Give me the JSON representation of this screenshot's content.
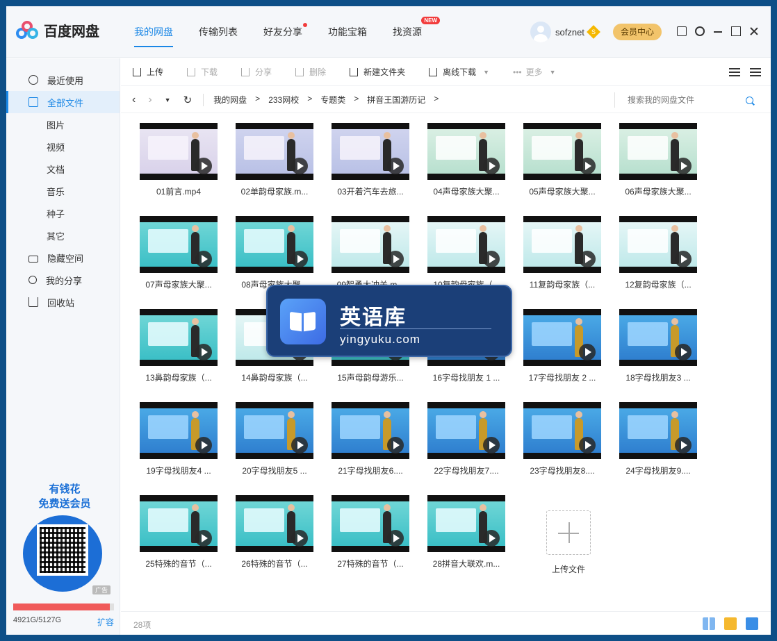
{
  "app": {
    "name": "百度网盘"
  },
  "nav": [
    {
      "label": "我的网盘",
      "active": true
    },
    {
      "label": "传输列表"
    },
    {
      "label": "好友分享",
      "dot": true
    },
    {
      "label": "功能宝箱"
    },
    {
      "label": "找资源",
      "badge": "NEW"
    }
  ],
  "user": {
    "name": "sofznet",
    "vip_mark": "S",
    "member_button": "会员中心"
  },
  "sidebar": {
    "items": [
      {
        "label": "最近使用",
        "icon": "clock-icon"
      },
      {
        "label": "全部文件",
        "icon": "document-icon",
        "active": true
      },
      {
        "label": "图片"
      },
      {
        "label": "视频"
      },
      {
        "label": "文档"
      },
      {
        "label": "音乐"
      },
      {
        "label": "种子"
      },
      {
        "label": "其它"
      },
      {
        "label": "隐藏空间",
        "icon": "lock-icon"
      },
      {
        "label": "我的分享",
        "icon": "share-icon"
      },
      {
        "label": "回收站",
        "icon": "trash-icon"
      }
    ],
    "ad": {
      "line1": "有钱花",
      "line2": "免费送会员",
      "tag": "广告"
    },
    "quota": {
      "text": "4921G/5127G",
      "used_fraction": 0.96,
      "expand_label": "扩容"
    }
  },
  "toolbar": {
    "upload": "上传",
    "download": "下载",
    "share": "分享",
    "delete": "删除",
    "new_folder": "新建文件夹",
    "offline_download": "离线下载",
    "more": "更多"
  },
  "path": {
    "crumbs": [
      "我的网盘",
      "233网校",
      "专题类",
      "拼音王国游历记"
    ],
    "separator": ">",
    "search_placeholder": "搜索我的网盘文件"
  },
  "files": [
    {
      "name": "01前言.mp4",
      "theme": "purple"
    },
    {
      "name": "02单韵母家族.m...",
      "theme": "lilac"
    },
    {
      "name": "03开着汽车去旅...",
      "theme": "lilac"
    },
    {
      "name": "04声母家族大聚...",
      "theme": "green"
    },
    {
      "name": "05声母家族大聚...",
      "theme": "green"
    },
    {
      "name": "06声母家族大聚...",
      "theme": "green"
    },
    {
      "name": "07声母家族大聚...",
      "theme": "teal"
    },
    {
      "name": "08声母家族大聚...",
      "theme": "teal"
    },
    {
      "name": "09智勇大冲关.m...",
      "theme": "lightteal"
    },
    {
      "name": "10复韵母家族（...",
      "theme": "lightteal"
    },
    {
      "name": "11复韵母家族（...",
      "theme": "lightteal"
    },
    {
      "name": "12复韵母家族（...",
      "theme": "lightteal"
    },
    {
      "name": "13鼻韵母家族（...",
      "theme": "teal"
    },
    {
      "name": "14鼻韵母家族（...",
      "theme": "lightteal"
    },
    {
      "name": "15声母韵母游乐...",
      "theme": "teal"
    },
    {
      "name": "16字母找朋友 1 ...",
      "theme": "blue"
    },
    {
      "name": "17字母找朋友 2 ...",
      "theme": "blue"
    },
    {
      "name": "18字母找朋友3 ...",
      "theme": "blue"
    },
    {
      "name": "19字母找朋友4 ...",
      "theme": "blue"
    },
    {
      "name": "20字母找朋友5 ...",
      "theme": "blue"
    },
    {
      "name": "21字母找朋友6....",
      "theme": "blue"
    },
    {
      "name": "22字母找朋友7....",
      "theme": "blue"
    },
    {
      "name": "23字母找朋友8....",
      "theme": "blue"
    },
    {
      "name": "24字母找朋友9....",
      "theme": "blue"
    },
    {
      "name": "25特殊的音节（...",
      "theme": "teal"
    },
    {
      "name": "26特殊的音节（...",
      "theme": "teal"
    },
    {
      "name": "27特殊的音节（...",
      "theme": "teal"
    },
    {
      "name": "28拼音大联欢.m...",
      "theme": "teal"
    }
  ],
  "upload_tile": {
    "label": "上传文件"
  },
  "footer": {
    "count": "28项"
  },
  "watermark": {
    "title": "英语库",
    "url": "yingyuku.com"
  }
}
